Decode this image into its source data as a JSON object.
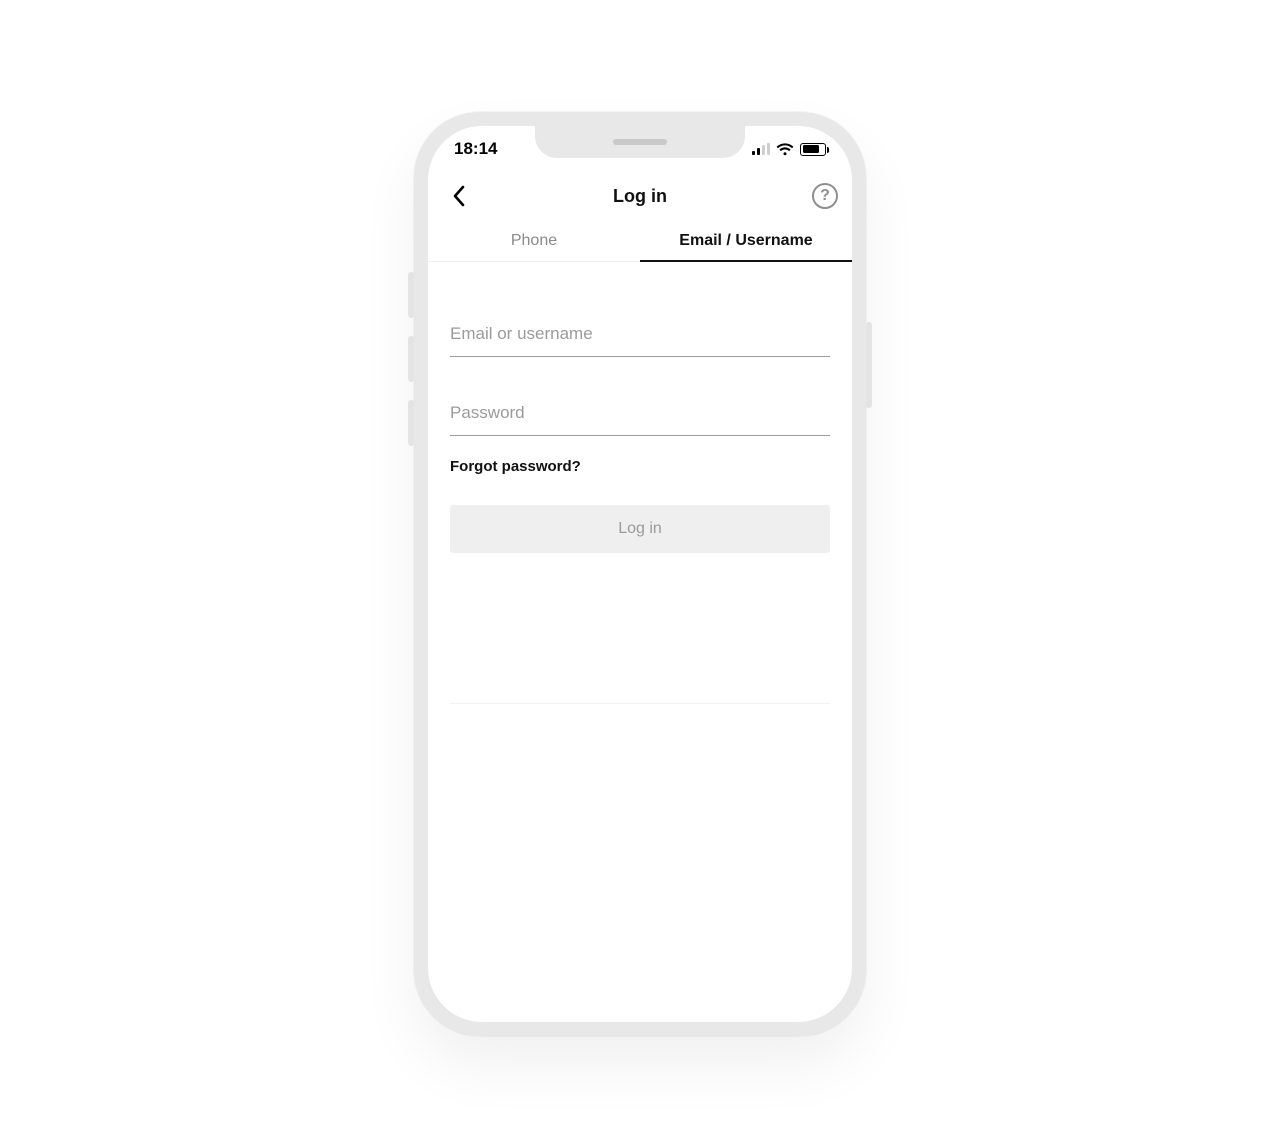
{
  "status_bar": {
    "time": "18:14"
  },
  "header": {
    "title": "Log in",
    "help_glyph": "?"
  },
  "tabs": {
    "phone": "Phone",
    "email": "Email / Username"
  },
  "form": {
    "email_placeholder": "Email or username",
    "password_placeholder": "Password",
    "forgot": "Forgot password?",
    "submit": "Log in"
  }
}
